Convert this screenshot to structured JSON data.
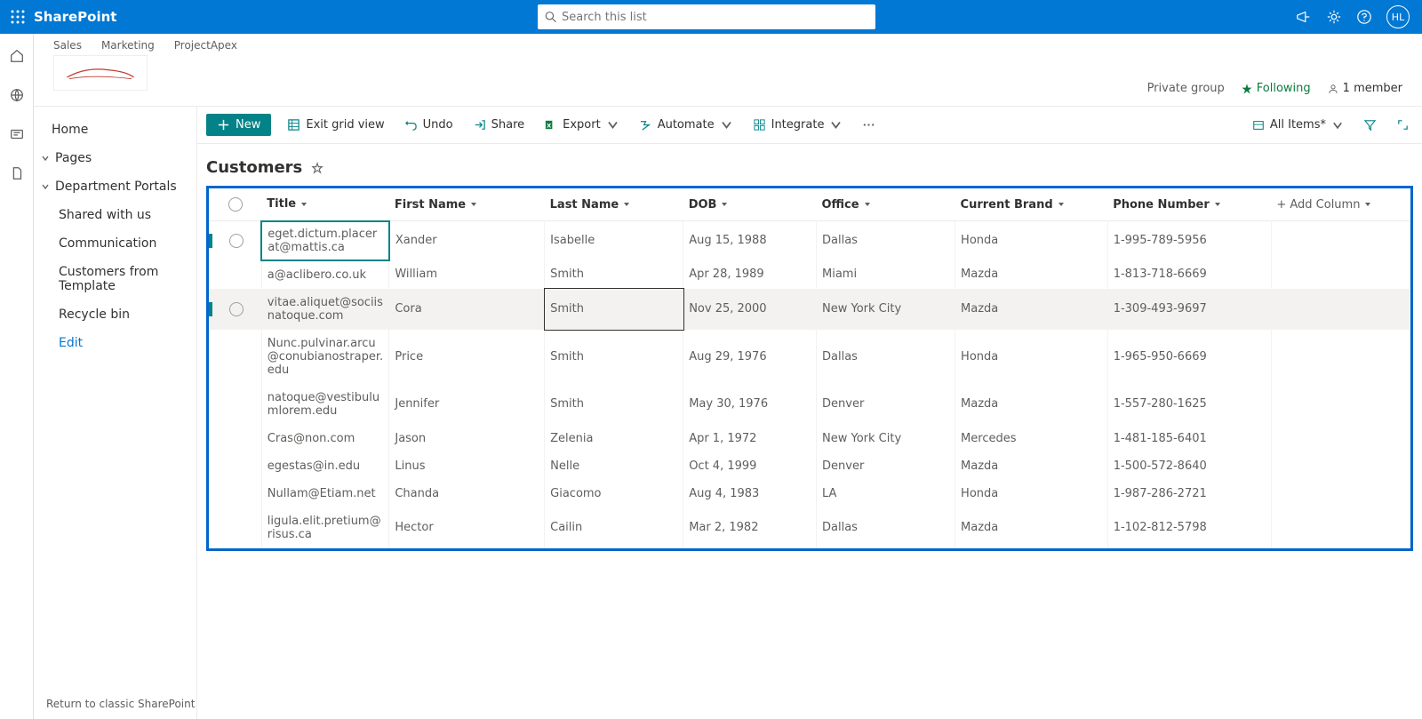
{
  "header": {
    "appname": "SharePoint",
    "searchPlaceholder": "Search this list",
    "avatar": "HL"
  },
  "siteLinks": [
    "Sales",
    "Marketing",
    "ProjectApex"
  ],
  "siteMeta": {
    "privacy": "Private group",
    "following": "Following",
    "members": "1 member"
  },
  "leftnav": {
    "home": "Home",
    "pages": "Pages",
    "portals": "Department Portals",
    "shared": "Shared with us",
    "comm": "Communication",
    "custtpl": "Customers from Template",
    "recycle": "Recycle bin",
    "edit": "Edit",
    "classic": "Return to classic SharePoint"
  },
  "cmdbar": {
    "new": "New",
    "exitgrid": "Exit grid view",
    "undo": "Undo",
    "share": "Share",
    "export": "Export",
    "automate": "Automate",
    "integrate": "Integrate",
    "allitems": "All Items*"
  },
  "list": {
    "title": "Customers"
  },
  "columns": {
    "title": "Title",
    "first": "First Name",
    "last": "Last Name",
    "dob": "DOB",
    "office": "Office",
    "brand": "Current Brand",
    "phone": "Phone Number",
    "add": "+ Add Column"
  },
  "rows": [
    {
      "title": "eget.dictum.placerat@mattis.ca",
      "first": "Xander",
      "last": "Isabelle",
      "dob": "Aug 15, 1988",
      "office": "Dallas",
      "brand": "Honda",
      "phone": "1-995-789-5956"
    },
    {
      "title": "a@aclibero.co.uk",
      "first": "William",
      "last": "Smith",
      "dob": "Apr 28, 1989",
      "office": "Miami",
      "brand": "Mazda",
      "phone": "1-813-718-6669"
    },
    {
      "title": "vitae.aliquet@sociisnatoque.com",
      "first": "Cora",
      "last": "Smith",
      "dob": "Nov 25, 2000",
      "office": "New York City",
      "brand": "Mazda",
      "phone": "1-309-493-9697"
    },
    {
      "title": "Nunc.pulvinar.arcu@conubianostraper.edu",
      "first": "Price",
      "last": "Smith",
      "dob": "Aug 29, 1976",
      "office": "Dallas",
      "brand": "Honda",
      "phone": "1-965-950-6669"
    },
    {
      "title": "natoque@vestibulumlorem.edu",
      "first": "Jennifer",
      "last": "Smith",
      "dob": "May 30, 1976",
      "office": "Denver",
      "brand": "Mazda",
      "phone": "1-557-280-1625"
    },
    {
      "title": "Cras@non.com",
      "first": "Jason",
      "last": "Zelenia",
      "dob": "Apr 1, 1972",
      "office": "New York City",
      "brand": "Mercedes",
      "phone": "1-481-185-6401"
    },
    {
      "title": "egestas@in.edu",
      "first": "Linus",
      "last": "Nelle",
      "dob": "Oct 4, 1999",
      "office": "Denver",
      "brand": "Mazda",
      "phone": "1-500-572-8640"
    },
    {
      "title": "Nullam@Etiam.net",
      "first": "Chanda",
      "last": "Giacomo",
      "dob": "Aug 4, 1983",
      "office": "LA",
      "brand": "Honda",
      "phone": "1-987-286-2721"
    },
    {
      "title": "ligula.elit.pretium@risus.ca",
      "first": "Hector",
      "last": "Cailin",
      "dob": "Mar 2, 1982",
      "office": "Dallas",
      "brand": "Mazda",
      "phone": "1-102-812-5798"
    }
  ]
}
